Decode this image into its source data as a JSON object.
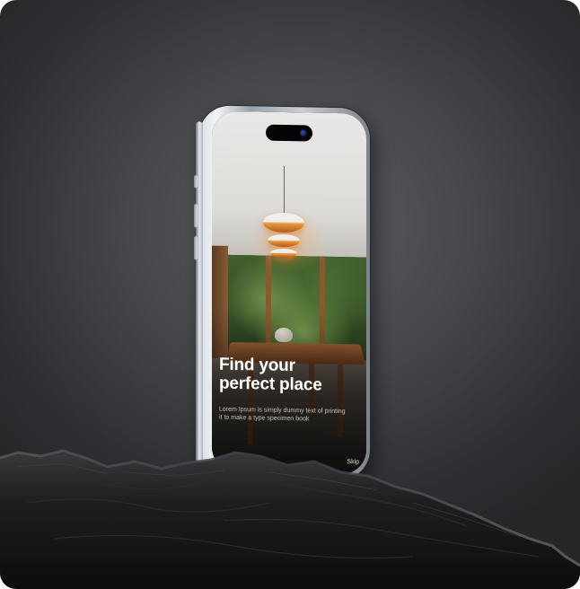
{
  "onboarding": {
    "headline_line1": "Find your",
    "headline_line2": "perfect place",
    "body_line1": "Lorem Ipsum is simply dummy text of printing",
    "body_line2": "it to make a type specimen book",
    "skip_label": "Skip"
  },
  "icons": {
    "camera": "front-camera-icon"
  },
  "colors": {
    "headline": "#ffffff",
    "body": "#ffffffb8",
    "lamp_accent": "#e79a3b",
    "background": "#45454a"
  }
}
